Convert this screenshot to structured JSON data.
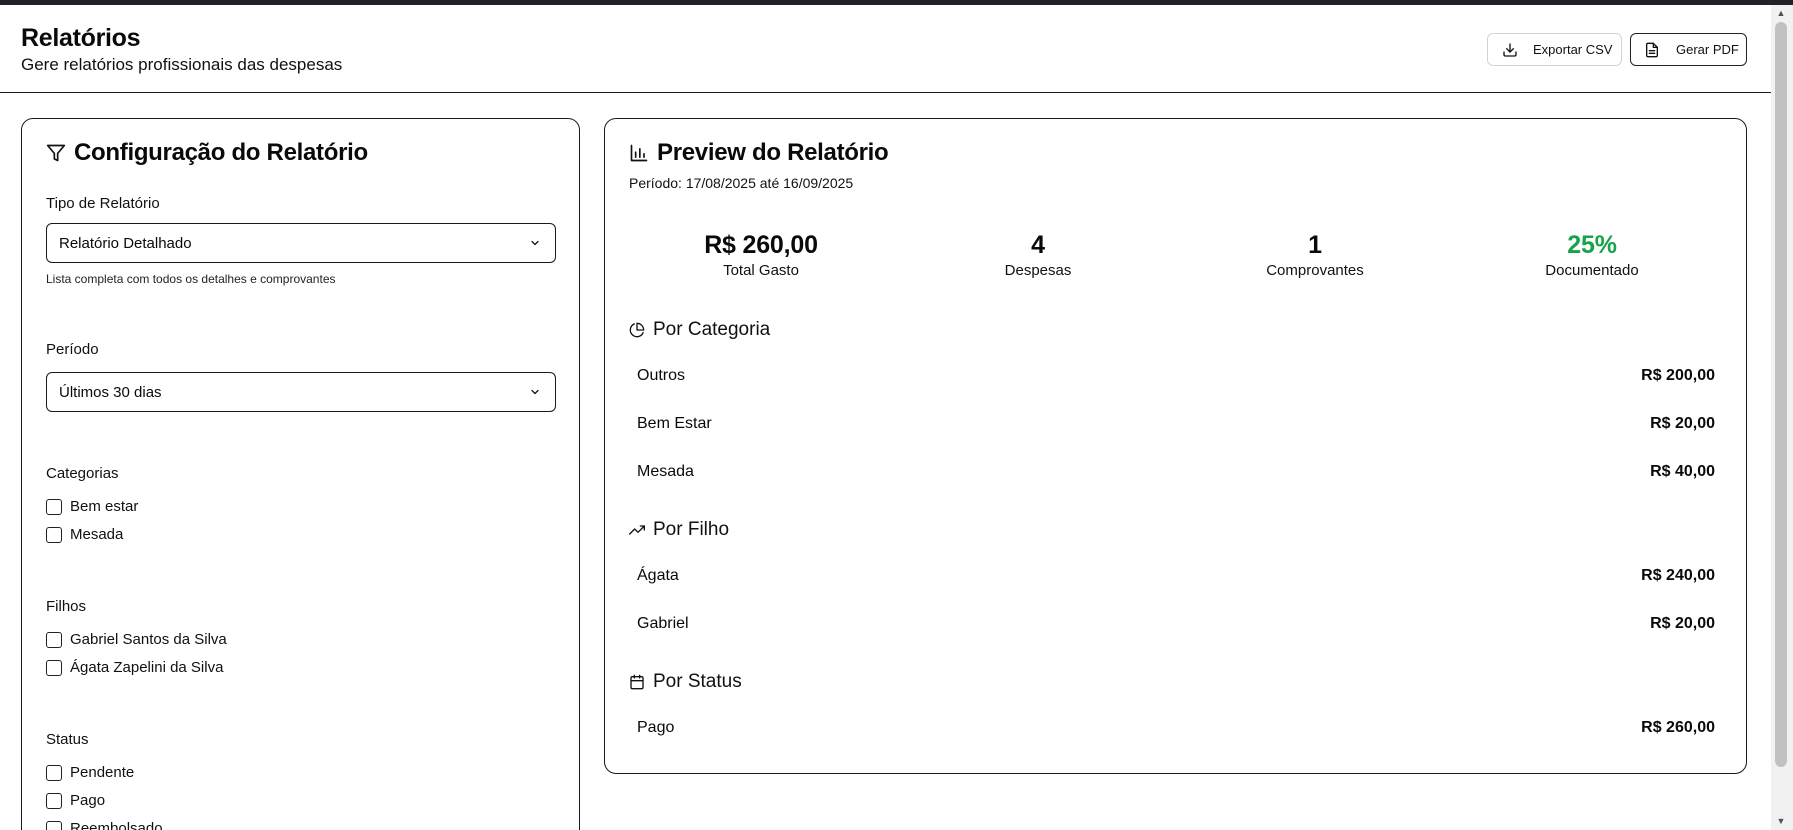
{
  "header": {
    "title": "Relatórios",
    "subtitle": "Gere relatórios profissionais das despesas",
    "export_csv_label": "Exportar CSV",
    "generate_pdf_label": "Gerar PDF"
  },
  "config": {
    "title": "Configuração do Relatório",
    "report_type": {
      "label": "Tipo de Relatório",
      "selected": "Relatório Detalhado",
      "hint": "Lista completa com todos os detalhes e comprovantes"
    },
    "period": {
      "label": "Período",
      "selected": "Últimos 30 dias"
    },
    "categories": {
      "label": "Categorias",
      "options": [
        {
          "label": "Bem estar",
          "checked": false
        },
        {
          "label": "Mesada",
          "checked": false
        }
      ]
    },
    "children": {
      "label": "Filhos",
      "options": [
        {
          "label": "Gabriel Santos da Silva",
          "checked": false
        },
        {
          "label": "Ágata Zapelini da Silva",
          "checked": false
        }
      ]
    },
    "status": {
      "label": "Status",
      "options": [
        {
          "label": "Pendente",
          "checked": false
        },
        {
          "label": "Pago",
          "checked": false
        },
        {
          "label": "Reembolsado",
          "checked": false
        }
      ]
    }
  },
  "preview": {
    "title": "Preview do Relatório",
    "period_text": "Período: 17/08/2025 até 16/09/2025",
    "stats": [
      {
        "value": "R$ 260,00",
        "label": "Total Gasto",
        "color": "#0a0a0a"
      },
      {
        "value": "4",
        "label": "Despesas",
        "color": "#0a0a0a"
      },
      {
        "value": "1",
        "label": "Comprovantes",
        "color": "#0a0a0a"
      },
      {
        "value": "25%",
        "label": "Documentado",
        "color": "#16a34a"
      }
    ],
    "by_category": {
      "title": "Por Categoria",
      "rows": [
        {
          "name": "Outros",
          "amount": "R$ 200,00"
        },
        {
          "name": "Bem Estar",
          "amount": "R$ 20,00"
        },
        {
          "name": "Mesada",
          "amount": "R$ 40,00"
        }
      ]
    },
    "by_child": {
      "title": "Por Filho",
      "rows": [
        {
          "name": "Ágata",
          "amount": "R$ 240,00"
        },
        {
          "name": "Gabriel",
          "amount": "R$ 20,00"
        }
      ]
    },
    "by_status": {
      "title": "Por Status",
      "rows": [
        {
          "name": "Pago",
          "amount": "R$ 260,00"
        }
      ]
    }
  }
}
